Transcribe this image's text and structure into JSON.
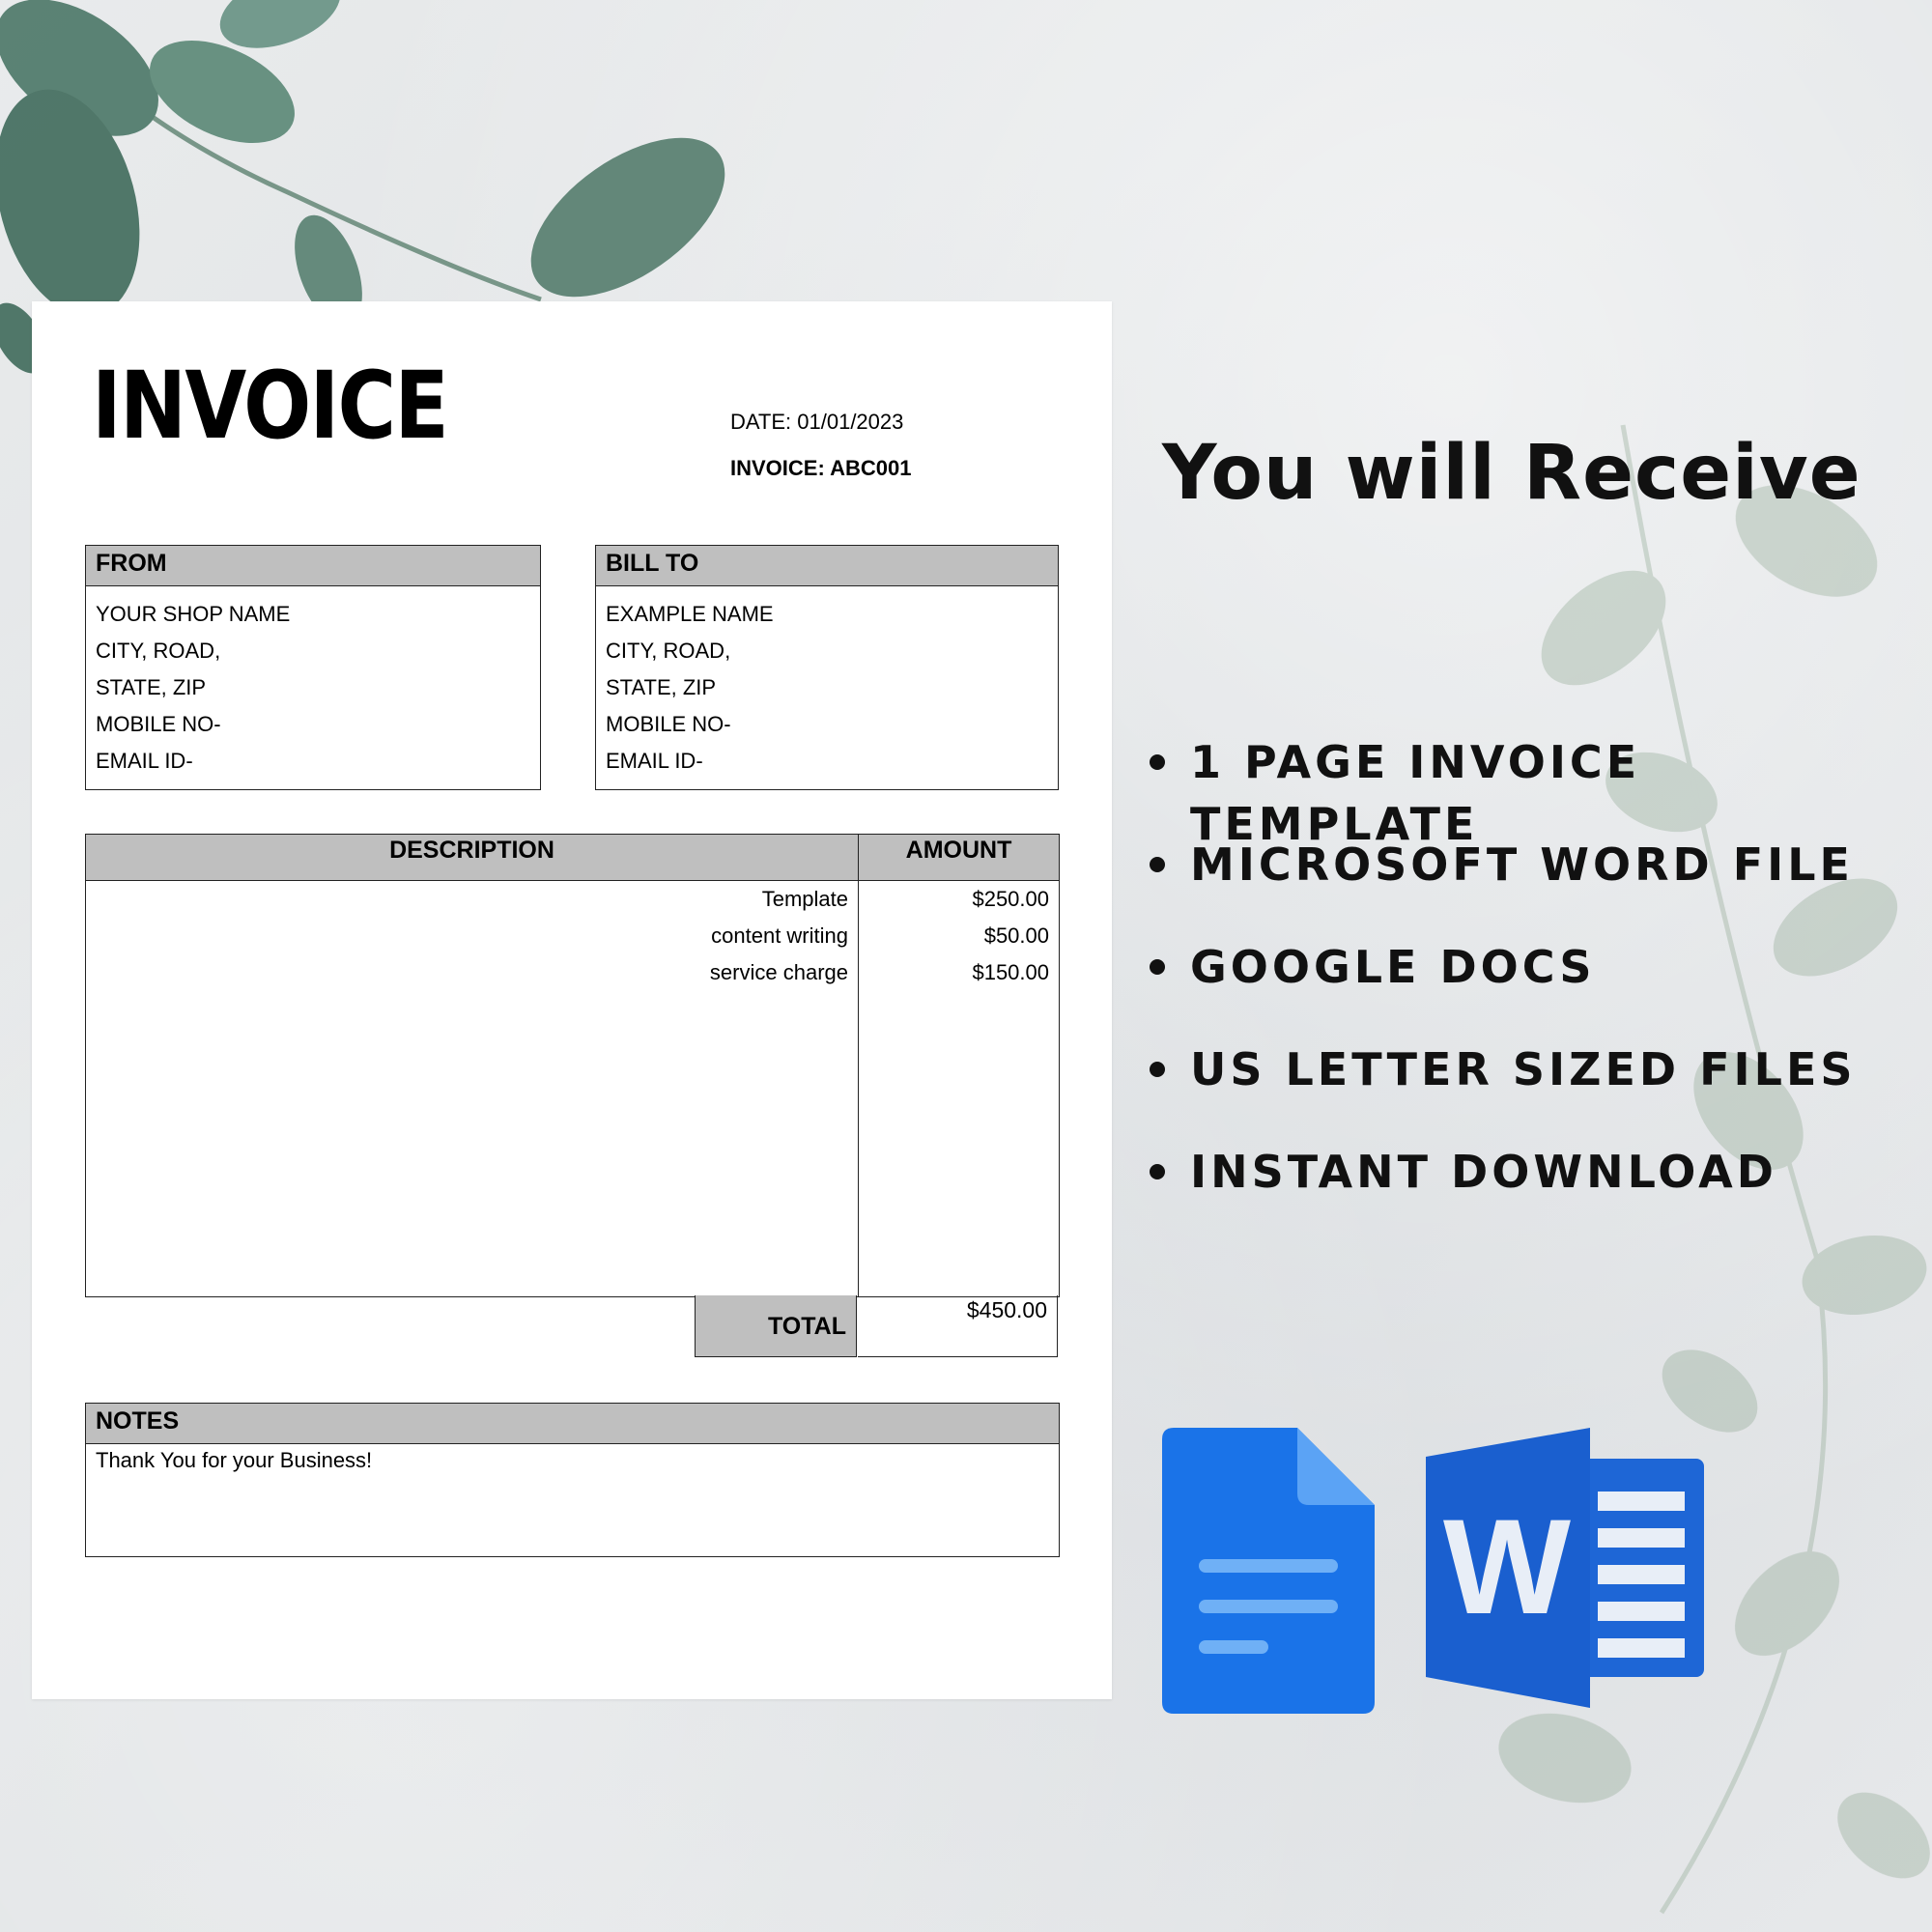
{
  "invoice": {
    "title": "INVOICE",
    "date": "DATE: 01/01/2023",
    "number": "INVOICE: ABC001",
    "from": {
      "header": "FROM",
      "lines": [
        "YOUR SHOP NAME",
        "CITY, ROAD,",
        "STATE, ZIP",
        "MOBILE NO-",
        "EMAIL ID-"
      ]
    },
    "bill_to": {
      "header": "BILL TO",
      "lines": [
        "EXAMPLE NAME",
        "CITY, ROAD,",
        "STATE, ZIP",
        "MOBILE NO-",
        "EMAIL ID-"
      ]
    },
    "table": {
      "description_header": "DESCRIPTION",
      "amount_header": "AMOUNT",
      "rows": [
        {
          "description": "Template",
          "amount": "$250.00"
        },
        {
          "description": "content writing",
          "amount": "$50.00"
        },
        {
          "description": "service charge",
          "amount": "$150.00"
        }
      ]
    },
    "total_label": "TOTAL",
    "total_value": "$450.00",
    "notes": {
      "header": "NOTES",
      "text": "Thank You for your Business!"
    }
  },
  "promo": {
    "heading": "You will Receive",
    "features": [
      "1 PAGE INVOICE TEMPLATE",
      "MICROSOFT WORD FILE",
      "GOOGLE DOCS",
      "US LETTER SIZED FILES",
      "INSTANT DOWNLOAD"
    ]
  },
  "icons": {
    "google_docs": "google-docs-icon",
    "word": "microsoft-word-icon",
    "word_letter": "W",
    "leaves": "eucalyptus-leaves"
  },
  "colors": {
    "background": "#e4e6e8",
    "table_header_gray": "#bfbfbf",
    "docs_blue": "#1a73e8",
    "word_blue": "#1e66d6",
    "leaf_green": "#4f7a6a"
  }
}
